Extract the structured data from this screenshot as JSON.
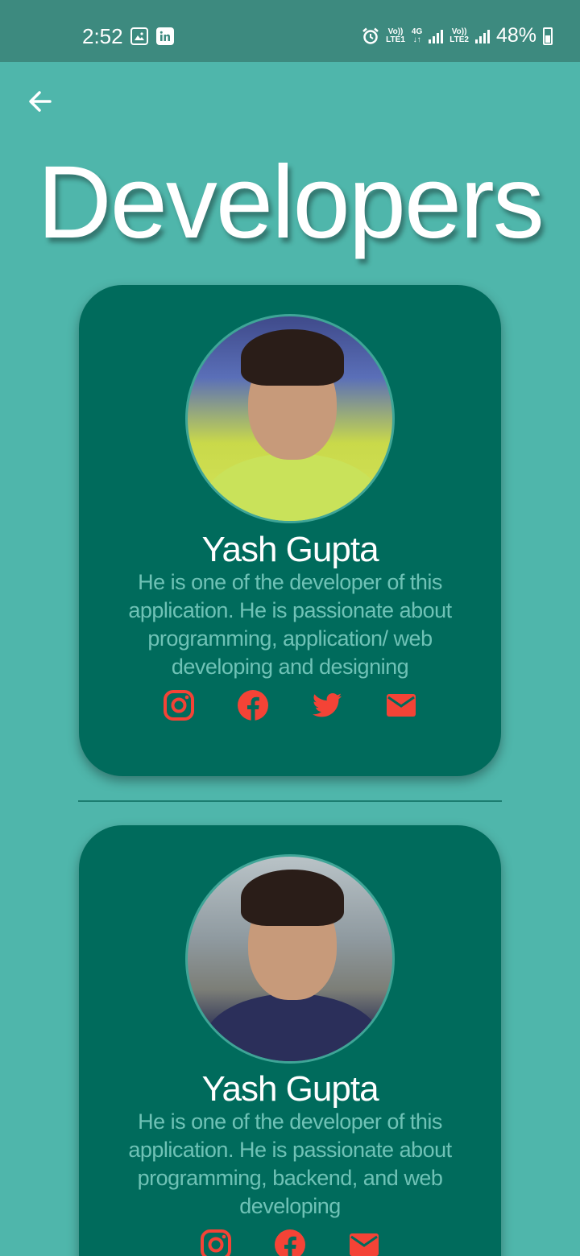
{
  "status_bar": {
    "time": "2:52",
    "sim1_top": "Vo))",
    "sim1_bottom": "LTE1",
    "net_top": "4G",
    "net_bottom": "↓↑",
    "sim2_top": "Vo))",
    "sim2_bottom": "LTE2",
    "battery": "48%"
  },
  "page": {
    "title": "Developers"
  },
  "developers": [
    {
      "name": "Yash Gupta",
      "description": "He is one of the developer of this application. He is passionate about programming, application/ web developing and designing",
      "socials": [
        "instagram-icon",
        "facebook-icon",
        "twitter-icon",
        "email-icon"
      ]
    },
    {
      "name": "Yash Gupta",
      "description": "He is one of the developer of this application. He is passionate about programming, backend, and web developing",
      "socials": [
        "instagram-icon",
        "facebook-icon",
        "email-icon"
      ]
    }
  ],
  "colors": {
    "background": "#4fb6ab",
    "card": "#006b5c",
    "accent_icon": "#f44336",
    "description_text": "#6fc2b6"
  }
}
